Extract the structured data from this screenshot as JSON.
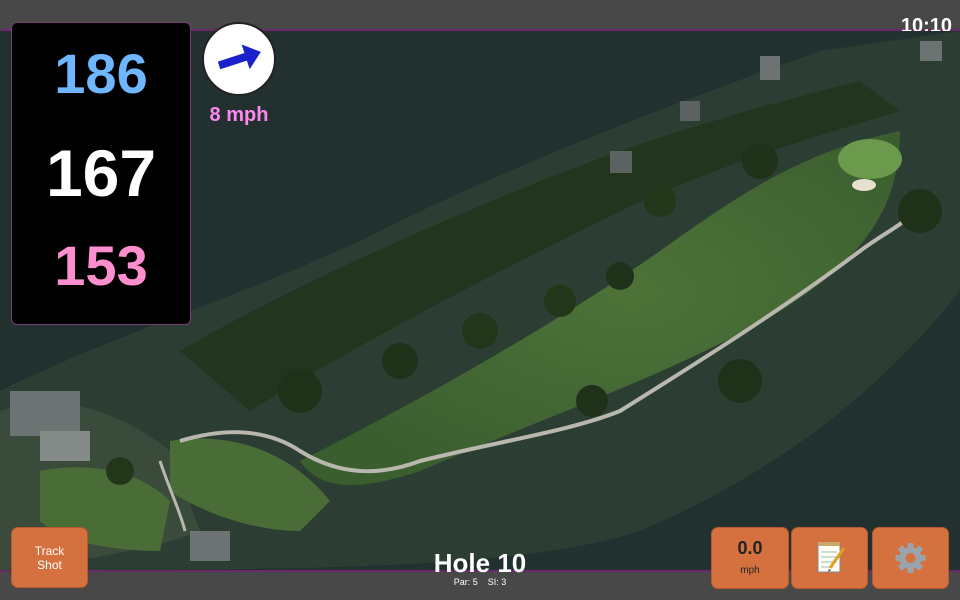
{
  "status": {
    "time": "10:10"
  },
  "distances": {
    "back": "186",
    "middle": "167",
    "front": "153"
  },
  "wind": {
    "speed_label": "8 mph",
    "icon": "wind-arrow-icon",
    "direction": "east-northeast"
  },
  "hole": {
    "title": "Hole 10",
    "par_label": "Par: 5",
    "si_label": "SI: 3"
  },
  "buttons": {
    "track_shot_line1": "Track",
    "track_shot_line2": "Shot",
    "speed_value": "0.0",
    "speed_unit": "mph",
    "notes_icon": "notepad-icon",
    "settings_icon": "gear-icon"
  },
  "colors": {
    "back": "#6fb6ff",
    "middle": "#ffffff",
    "front": "#ff8ecf",
    "wind_text": "#ff88ee",
    "button": "#d4713f",
    "bar": "#484848",
    "bar_border": "#6a2a6a"
  }
}
